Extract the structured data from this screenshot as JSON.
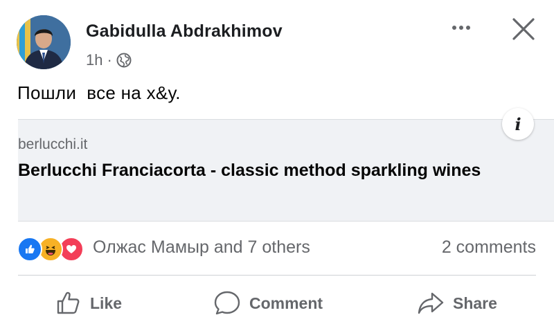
{
  "post": {
    "author": "Gabidulla Abdrakhimov",
    "time": "1h",
    "separator": "·",
    "audience_icon": "globe-icon",
    "text": "Пошли  все на х&у."
  },
  "link_preview": {
    "domain": "berlucchi.it",
    "title": "Berlucchi Franciacorta - classic method sparkling wines",
    "info_label": "i"
  },
  "engagement": {
    "reaction_icons": [
      "like-reaction-icon",
      "haha-reaction-icon",
      "love-reaction-icon"
    ],
    "reactors": "Олжас Мамыр and 7 others",
    "comments": "2 comments"
  },
  "actions": {
    "like": "Like",
    "comment": "Comment",
    "share": "Share"
  },
  "colors": {
    "meta_gray": "#65676b",
    "like_blue": "#1877f2",
    "haha_yellow": "#f7b125",
    "love_red": "#f33e58",
    "card_bg": "#f0f2f5"
  }
}
